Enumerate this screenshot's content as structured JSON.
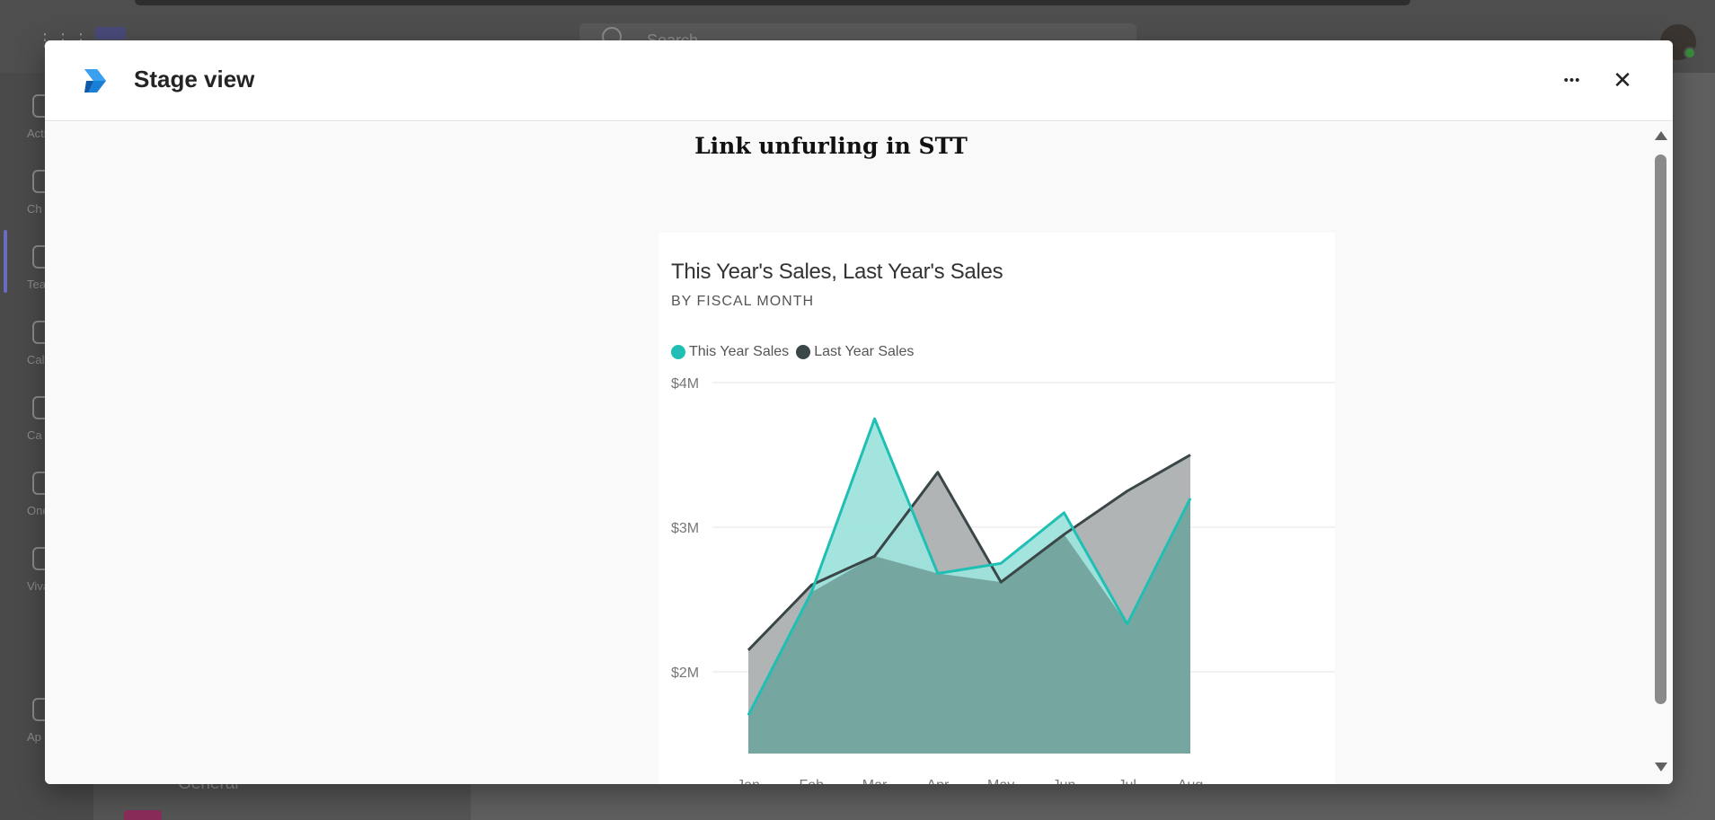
{
  "background": {
    "search_placeholder": "Search",
    "rail_items": [
      {
        "label": "Acti",
        "top": 8
      },
      {
        "label": "Ch",
        "top": 92
      },
      {
        "label": "Tea",
        "top": 176
      },
      {
        "label": "Cale",
        "top": 260
      },
      {
        "label": "Ca",
        "top": 344
      },
      {
        "label": "One",
        "top": 428
      },
      {
        "label": "Viva C",
        "top": 512
      },
      {
        "label": "Ap",
        "top": 680
      }
    ],
    "panel_channel": "General"
  },
  "modal": {
    "title": "Stage view",
    "more_label": "•••",
    "close_label": "✕"
  },
  "content": {
    "title": "Link unfurling in STT"
  },
  "colors": {
    "this_year": "#1fbfb4",
    "last_year": "#3b4648",
    "overlap": "#75a6a0"
  },
  "chart_data": {
    "type": "area",
    "title": "This Year's Sales, Last Year's Sales",
    "subtitle": "BY FISCAL MONTH",
    "categories": [
      "Jan",
      "Feb",
      "Mar",
      "Apr",
      "May",
      "Jun",
      "Jul",
      "Aug"
    ],
    "series": [
      {
        "name": "This Year Sales",
        "values": [
          1.7,
          2.55,
          3.75,
          2.68,
          2.75,
          3.1,
          2.33,
          3.2
        ]
      },
      {
        "name": "Last Year Sales",
        "values": [
          2.15,
          2.6,
          2.8,
          3.38,
          2.62,
          2.95,
          3.25,
          3.5
        ]
      }
    ],
    "yticks": [
      "$4M",
      "$3M",
      "$2M"
    ],
    "ytick_values": [
      4,
      3,
      2
    ],
    "ylim": [
      1.5,
      4
    ],
    "legend_position": "top-left",
    "grid": true
  }
}
